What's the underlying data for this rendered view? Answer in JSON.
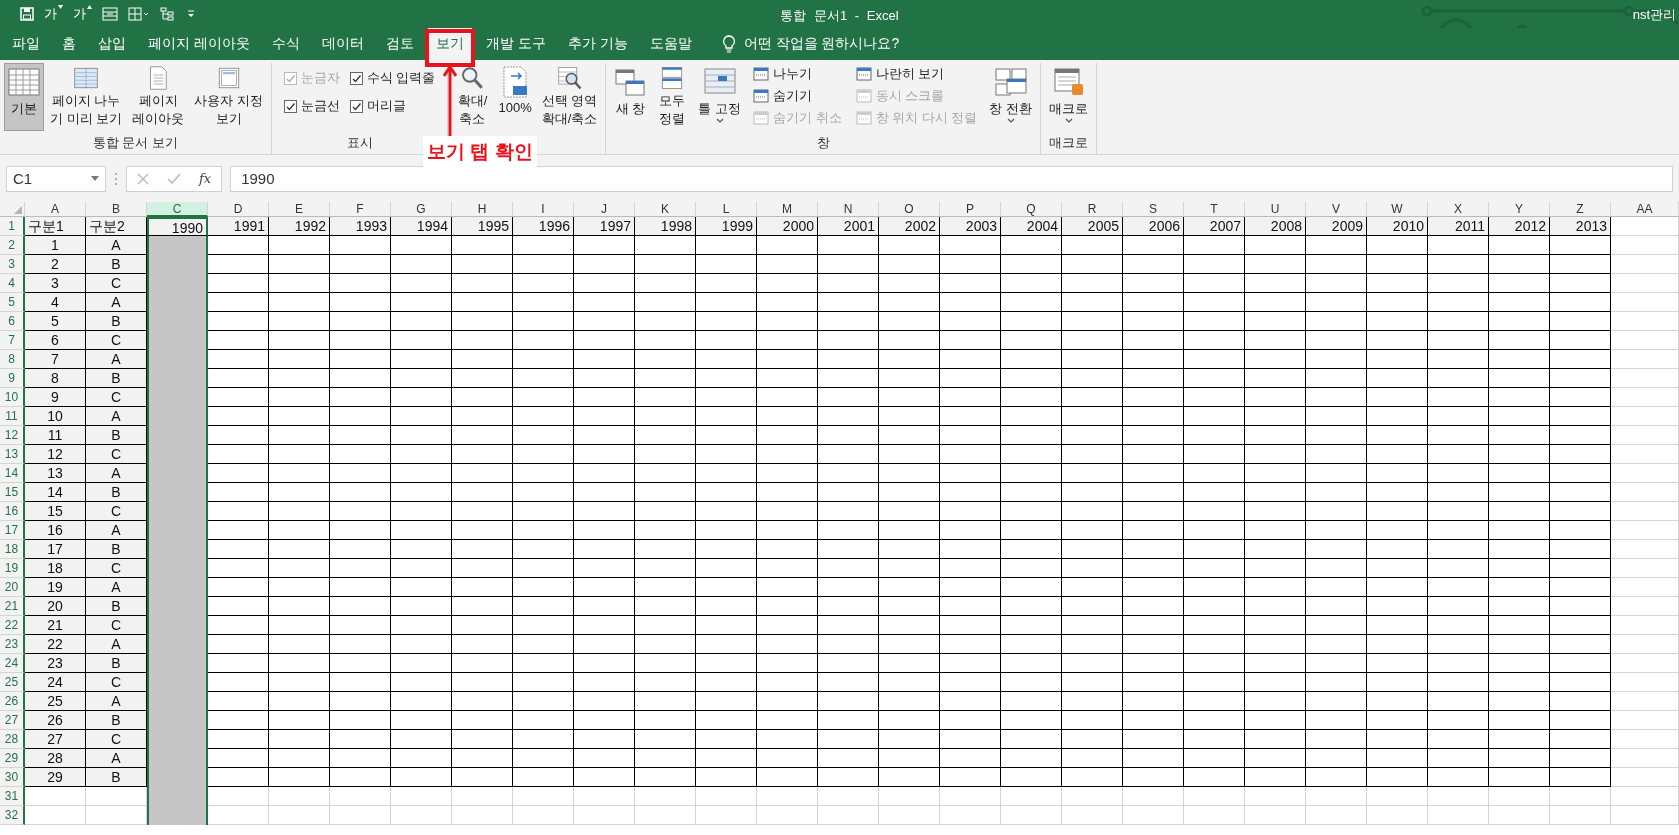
{
  "title_bar": {
    "font_buttons": [
      "가",
      "가"
    ],
    "title": "통합 문서1 - Excel",
    "user": "nst관리"
  },
  "tabs": [
    {
      "label": "파일",
      "selected": false
    },
    {
      "label": "홈",
      "selected": false
    },
    {
      "label": "삽입",
      "selected": false
    },
    {
      "label": "페이지 레이아웃",
      "selected": false
    },
    {
      "label": "수식",
      "selected": false
    },
    {
      "label": "데이터",
      "selected": false
    },
    {
      "label": "검토",
      "selected": false
    },
    {
      "label": "보기",
      "selected": true
    },
    {
      "label": "개발 도구",
      "selected": false
    },
    {
      "label": "추가 기능",
      "selected": false
    },
    {
      "label": "도움말",
      "selected": false
    }
  ],
  "search": {
    "placeholder": "어떤 작업을 원하시나요?"
  },
  "ribbon": {
    "groups": [
      {
        "label": "통합 문서 보기",
        "items": [
          {
            "kind": "large",
            "label": "기본",
            "selected": true
          },
          {
            "kind": "large",
            "label": "페이지 나누\n기 미리 보기",
            "selected": false
          },
          {
            "kind": "large",
            "label": "페이지\n레이아웃",
            "selected": false
          },
          {
            "kind": "large",
            "label": "사용자 지정\n보기",
            "selected": false
          }
        ]
      },
      {
        "label": "표시",
        "items": [
          {
            "kind": "check",
            "label": "눈금자",
            "checked": true,
            "disabled": true
          },
          {
            "kind": "check",
            "label": "수식 입력줄",
            "checked": true,
            "disabled": false
          },
          {
            "kind": "check",
            "label": "눈금선",
            "checked": true,
            "disabled": false
          },
          {
            "kind": "check",
            "label": "머리글",
            "checked": true,
            "disabled": false
          }
        ]
      },
      {
        "items": [
          {
            "kind": "large",
            "label": "확대/\n축소"
          },
          {
            "kind": "large",
            "label": "100%"
          },
          {
            "kind": "large",
            "label": "선택 영역\n확대/축소"
          }
        ]
      },
      {
        "label": "창",
        "items": [
          {
            "kind": "large",
            "label": "새 창",
            "dropdown": false
          },
          {
            "kind": "large",
            "label": "모두\n정렬",
            "dropdown": false
          },
          {
            "kind": "large",
            "label": "틀 고정",
            "dropdown": true
          },
          {
            "kind": "small",
            "label": "나누기",
            "disabled": false
          },
          {
            "kind": "small",
            "label": "숨기기",
            "disabled": false
          },
          {
            "kind": "small",
            "label": "숨기기 취소",
            "disabled": true
          },
          {
            "kind": "small",
            "label": "나란히 보기",
            "disabled": false
          },
          {
            "kind": "small",
            "label": "동시 스크롤",
            "disabled": true
          },
          {
            "kind": "small",
            "label": "창 위치 다시 정렬",
            "disabled": true
          },
          {
            "kind": "large",
            "label": "창 전환",
            "dropdown": true
          }
        ]
      },
      {
        "label": "매크로",
        "items": [
          {
            "kind": "large",
            "label": "매크로",
            "dropdown": true
          }
        ]
      }
    ]
  },
  "formula_bar": {
    "name_box": "C1",
    "function_label": "fx",
    "value": "1990"
  },
  "sheet": {
    "columns": [
      {
        "label": "A",
        "selected": false
      },
      {
        "label": "B",
        "selected": false
      },
      {
        "label": "C",
        "selected": true
      },
      {
        "label": "D",
        "selected": false
      },
      {
        "label": "E",
        "selected": false
      },
      {
        "label": "F",
        "selected": false
      },
      {
        "label": "G",
        "selected": false
      },
      {
        "label": "H",
        "selected": false
      },
      {
        "label": "I",
        "selected": false
      },
      {
        "label": "J",
        "selected": false
      },
      {
        "label": "K",
        "selected": false
      },
      {
        "label": "L",
        "selected": false
      },
      {
        "label": "M",
        "selected": false
      },
      {
        "label": "N",
        "selected": false
      },
      {
        "label": "O",
        "selected": false
      },
      {
        "label": "P",
        "selected": false
      },
      {
        "label": "Q",
        "selected": false
      },
      {
        "label": "R",
        "selected": false
      },
      {
        "label": "S",
        "selected": false
      },
      {
        "label": "T",
        "selected": false
      },
      {
        "label": "U",
        "selected": false
      },
      {
        "label": "V",
        "selected": false
      },
      {
        "label": "W",
        "selected": false
      },
      {
        "label": "X",
        "selected": false
      },
      {
        "label": "Y",
        "selected": false
      },
      {
        "label": "Z",
        "selected": false
      },
      {
        "label": "AA",
        "selected": false
      }
    ],
    "rows": [
      {
        "number": "1",
        "kind": "header",
        "cells": [
          "구분1",
          "구분2",
          "1990",
          "1991",
          "1992",
          "1993",
          "1994",
          "1995",
          "1996",
          "1997",
          "1998",
          "1999",
          "2000",
          "2001",
          "2002",
          "2003",
          "2004",
          "2005",
          "2006",
          "2007",
          "2008",
          "2009",
          "2010",
          "2011",
          "2012",
          "2013"
        ]
      },
      {
        "number": "2",
        "kind": "data",
        "cells": [
          "1",
          "A"
        ]
      },
      {
        "number": "3",
        "kind": "data",
        "cells": [
          "2",
          "B"
        ]
      },
      {
        "number": "4",
        "kind": "data",
        "cells": [
          "3",
          "C"
        ]
      },
      {
        "number": "5",
        "kind": "data",
        "cells": [
          "4",
          "A"
        ]
      },
      {
        "number": "6",
        "kind": "data",
        "cells": [
          "5",
          "B"
        ]
      },
      {
        "number": "7",
        "kind": "data",
        "cells": [
          "6",
          "C"
        ]
      },
      {
        "number": "8",
        "kind": "data",
        "cells": [
          "7",
          "A"
        ]
      },
      {
        "number": "9",
        "kind": "data",
        "cells": [
          "8",
          "B"
        ]
      },
      {
        "number": "10",
        "kind": "data",
        "cells": [
          "9",
          "C"
        ]
      },
      {
        "number": "11",
        "kind": "data",
        "cells": [
          "10",
          "A"
        ]
      },
      {
        "number": "12",
        "kind": "data",
        "cells": [
          "11",
          "B"
        ]
      },
      {
        "number": "13",
        "kind": "data",
        "cells": [
          "12",
          "C"
        ]
      },
      {
        "number": "14",
        "kind": "data",
        "cells": [
          "13",
          "A"
        ]
      },
      {
        "number": "15",
        "kind": "data",
        "cells": [
          "14",
          "B"
        ]
      },
      {
        "number": "16",
        "kind": "data",
        "cells": [
          "15",
          "C"
        ]
      },
      {
        "number": "17",
        "kind": "data",
        "cells": [
          "16",
          "A"
        ]
      },
      {
        "number": "18",
        "kind": "data",
        "cells": [
          "17",
          "B"
        ]
      },
      {
        "number": "19",
        "kind": "data",
        "cells": [
          "18",
          "C"
        ]
      },
      {
        "number": "20",
        "kind": "data",
        "cells": [
          "19",
          "A"
        ]
      },
      {
        "number": "21",
        "kind": "data",
        "cells": [
          "20",
          "B"
        ]
      },
      {
        "number": "22",
        "kind": "data",
        "cells": [
          "21",
          "C"
        ]
      },
      {
        "number": "23",
        "kind": "data",
        "cells": [
          "22",
          "A"
        ]
      },
      {
        "number": "24",
        "kind": "data",
        "cells": [
          "23",
          "B"
        ]
      },
      {
        "number": "25",
        "kind": "data",
        "cells": [
          "24",
          "C"
        ]
      },
      {
        "number": "26",
        "kind": "data",
        "cells": [
          "25",
          "A"
        ]
      },
      {
        "number": "27",
        "kind": "data",
        "cells": [
          "26",
          "B"
        ]
      },
      {
        "number": "28",
        "kind": "data",
        "cells": [
          "27",
          "C"
        ]
      },
      {
        "number": "29",
        "kind": "data",
        "cells": [
          "28",
          "A"
        ]
      },
      {
        "number": "30",
        "kind": "data",
        "cells": [
          "29",
          "B"
        ]
      },
      {
        "number": "31",
        "kind": "empty"
      },
      {
        "number": "32",
        "kind": "empty"
      }
    ]
  },
  "annotation": {
    "text": "보기 탭 확인"
  }
}
